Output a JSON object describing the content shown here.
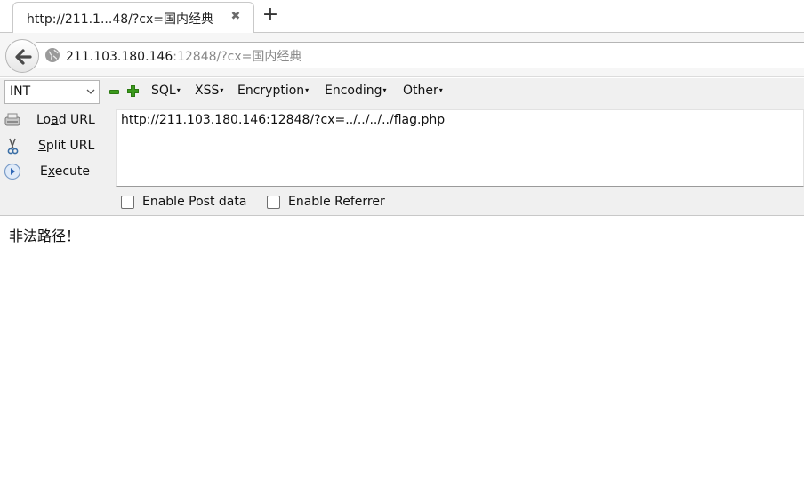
{
  "tab": {
    "title": "http://211.1...48/?cx=国内经典",
    "close_glyph": "✖",
    "new_tab_glyph": "+"
  },
  "navbar": {
    "url_host": "211.103.180.146",
    "url_rest": ":12848/?cx=国内经典"
  },
  "hackbar": {
    "type_select": "INT",
    "menus": {
      "sql": "SQL",
      "xss": "XSS",
      "encryption": "Encryption",
      "encoding": "Encoding",
      "other": "Other",
      "caret": "▾"
    },
    "side_buttons": {
      "load_prefix": "Lo",
      "load_key": "a",
      "load_suffix": "d URL",
      "split_key": "S",
      "split_suffix": "plit URL",
      "execute_prefix": "E",
      "execute_key": "x",
      "execute_suffix": "ecute"
    },
    "url_value": "http://211.103.180.146:12848/?cx=../../../../flag.php",
    "post_data_label": "Enable Post data",
    "referrer_label": "Enable Referrer"
  },
  "page": {
    "message": "非法路径！"
  },
  "colors": {
    "plus_green": "#3b9a1d",
    "url_grey": "#8a8a8a",
    "toolbar_bg": "#f0f0f0"
  }
}
